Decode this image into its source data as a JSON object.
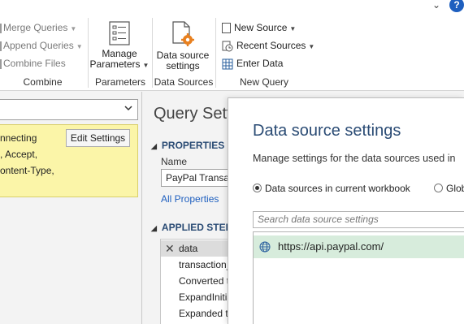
{
  "ribbon": {
    "combine": {
      "merge_queries": "Merge Queries",
      "append_queries": "Append Queries",
      "combine_files": "Combine Files",
      "group_label": "Combine"
    },
    "parameters": {
      "manage_line1": "Manage",
      "manage_line2": "Parameters",
      "group_label": "Parameters"
    },
    "data_sources": {
      "settings_line1": "Data source",
      "settings_line2": "settings",
      "group_label": "Data Sources"
    },
    "new_query": {
      "new_source": "New Source",
      "recent_sources": "Recent Sources",
      "enter_data": "Enter Data",
      "group_label": "New Query"
    }
  },
  "left_pane": {
    "notice": {
      "line1": "nnecting",
      "line2": ", Accept,",
      "line3": "ontent-Type,",
      "edit_settings": "Edit Settings"
    }
  },
  "query_settings": {
    "title": "Query Setti",
    "properties_header": "PROPERTIES",
    "name_label": "Name",
    "name_value": "PayPal Transacti",
    "all_properties": "All Properties",
    "applied_steps_header": "APPLIED STEPS",
    "steps": [
      {
        "label": "data"
      },
      {
        "label": "transaction_"
      },
      {
        "label": "Converted t"
      },
      {
        "label": "ExpandInitia"
      },
      {
        "label": "Expanded t"
      }
    ]
  },
  "dialog": {
    "title": "Data source settings",
    "description": "Manage settings for the data sources used in",
    "radio_current": "Data sources in current workbook",
    "radio_global": "Glob",
    "search_placeholder": "Search data source settings",
    "items": [
      {
        "label": "https://api.paypal.com/"
      }
    ]
  },
  "colors": {
    "accent_blue": "#2a4b74",
    "link_blue": "#1e5fbf",
    "notice_yellow": "#fbf5a8",
    "selected_green": "#d7ecdc"
  }
}
